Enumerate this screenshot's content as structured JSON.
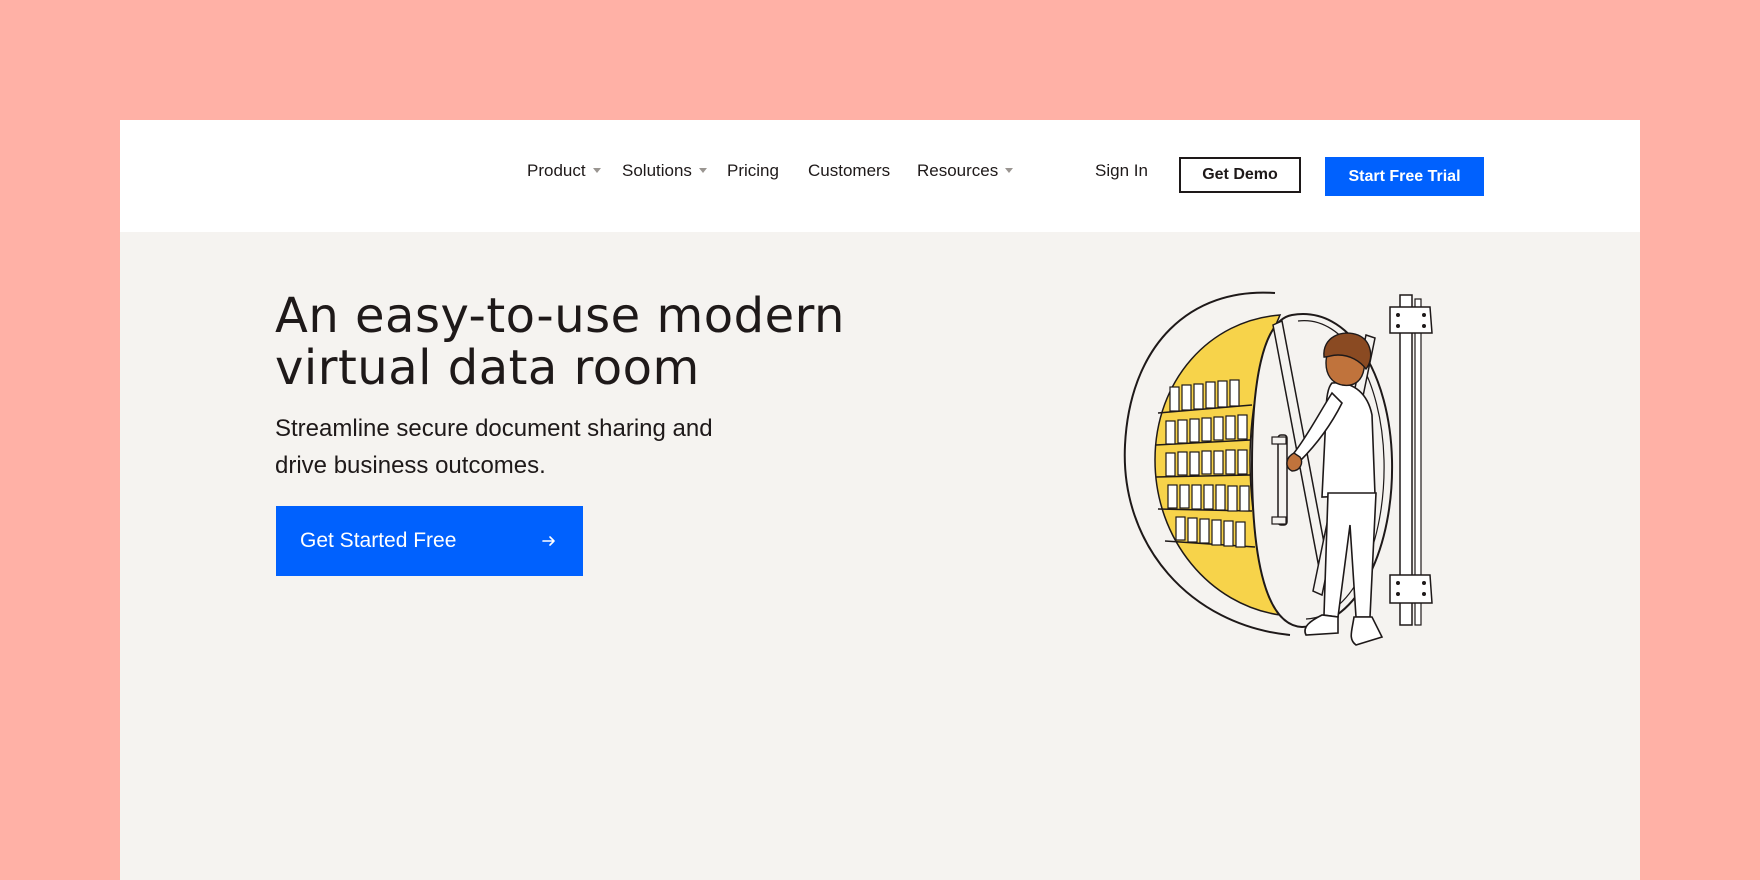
{
  "nav": {
    "items": [
      {
        "label": "Product",
        "has_dropdown": true
      },
      {
        "label": "Solutions",
        "has_dropdown": true
      },
      {
        "label": "Pricing",
        "has_dropdown": false
      },
      {
        "label": "Customers",
        "has_dropdown": false
      },
      {
        "label": "Resources",
        "has_dropdown": true
      }
    ],
    "sign_in": "Sign In",
    "get_demo": "Get Demo",
    "start_trial": "Start Free Trial"
  },
  "hero": {
    "title_line1": "An easy-to-use modern",
    "title_line2": "virtual data room",
    "subtitle_line1": "Streamline secure document sharing and",
    "subtitle_line2": "drive business outcomes.",
    "cta_label": "Get Started Free",
    "cta_icon": "arrow-right-icon"
  },
  "illustration": {
    "icon": "vault-door-person-illustration"
  },
  "colors": {
    "backdrop": "#ffb1a6",
    "page_bg": "#f5f3f0",
    "nav_bg": "#ffffff",
    "primary": "#0061fe",
    "text": "#1e1919",
    "vault_interior": "#f7d34a"
  }
}
